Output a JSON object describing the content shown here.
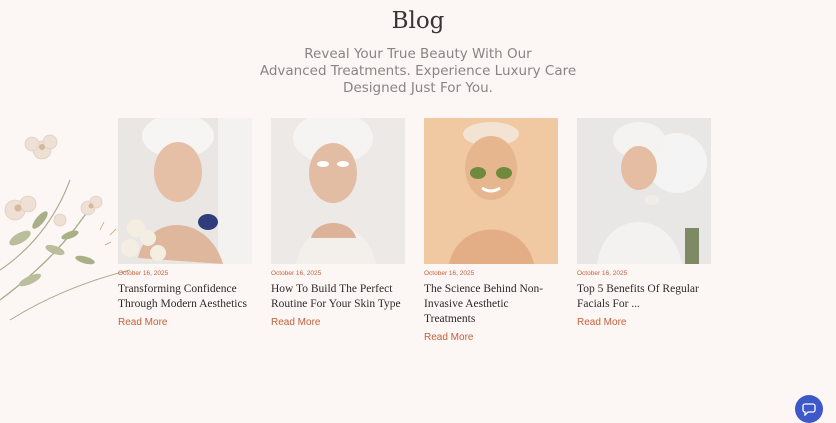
{
  "blog": {
    "heading": "Blog",
    "subtitle_lines": [
      "Reveal Your True Beauty With Our",
      "Advanced Treatments. Experience Luxury Care",
      "Designed Just For You."
    ]
  },
  "cards": [
    {
      "date": "October 16, 2025",
      "title_lines": [
        "Transforming Confidence",
        "Through Modern Aesthetics"
      ],
      "link": "Read More"
    },
    {
      "date": "October 16, 2025",
      "title_lines": [
        "How To Build The Perfect",
        "Routine For Your Skin Type"
      ],
      "link": "Read More"
    },
    {
      "date": "October 16, 2025",
      "title_lines": [
        "The Science Behind Non-",
        "Invasive Aesthetic",
        "Treatments"
      ],
      "link": "Read More"
    },
    {
      "date": "October 16, 2025",
      "title_lines": [
        "Top 5 Benefits Of Regular",
        "Facials For ..."
      ],
      "link": "Read More"
    }
  ],
  "colors": {
    "background": "#fcf6f4",
    "accent": "#c4603a",
    "chat_button": "#3d58c9"
  },
  "icons": {
    "chat": "chat-bubble-icon"
  }
}
